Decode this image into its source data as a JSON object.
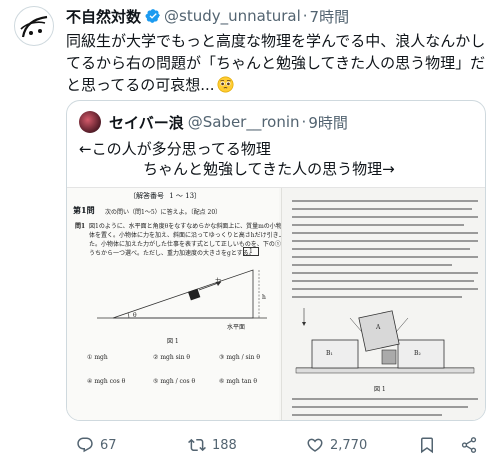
{
  "author": {
    "name": "不自然対数",
    "handle": "@study_unnatural",
    "time": "7時間"
  },
  "tweet_text": "同級生が大学でもっと高度な物理を学んでる中、浪人なんかしてるから右の問題が「ちゃんと勉強してきた人の思う物理」だと思ってるの可哀想...",
  "tweet_text_lines": [
    "同級生が大学でもっと高度な物理を学んでる中、浪人なんかし",
    "てるから右の問題が「ちゃんと勉強してきた人の思う物理」だ",
    "と思ってるの可哀想..."
  ],
  "quoted": {
    "name": "セイバー浪",
    "handle": "@Saber__ronin",
    "time": "9時間",
    "text_line1": "←この人が多分思ってる物理",
    "text_line2": "ちゃんと勉強してきた人の思う物理→",
    "image": {
      "left": {
        "answer_header": "〔解答番号",
        "answer_range": "1 〜 13〕",
        "q_title": "第1問",
        "q_subtitle": "次の問い（問1〜5）に答えよ。〔配点 20〕",
        "q_label": "問1",
        "q_body_1": "図1のように、水平面と角度θをなすなめらかな斜面上に、質量mの小物",
        "q_body_2": "体を置く。小物体に力を加え、斜面に沿ってゆっくりと高さhだけ引き上げ",
        "q_body_3": "た。小物体に加えた力がした仕事を表す式として正しいものを、下の①〜⑥の",
        "q_body_4": "うちから一つ選べ。ただし、重力加速度の大きさをgとする。",
        "answer_box": "1",
        "force_label": "力",
        "height_label": "h",
        "angle_label": "θ",
        "floor_label": "水平面",
        "fig_label": "図 1",
        "options": [
          {
            "num": "①",
            "text": "mgh"
          },
          {
            "num": "②",
            "text": "mgh sin θ"
          },
          {
            "num": "③",
            "text": "mgh / sin θ"
          },
          {
            "num": "④",
            "text": "mgh cos θ"
          },
          {
            "num": "⑤",
            "text": "mgh / cos θ"
          },
          {
            "num": "⑥",
            "text": "mgh tan θ"
          }
        ]
      },
      "right": {
        "fig_label": "図 1",
        "block_labels": [
          "B₁",
          "A",
          "B₂"
        ]
      }
    }
  },
  "actions": {
    "replies": "67",
    "retweets": "188",
    "likes": "2,770"
  },
  "colors": {
    "verified": "#1d9bf0",
    "secondary_text": "#536471",
    "border": "#cfd9de"
  }
}
